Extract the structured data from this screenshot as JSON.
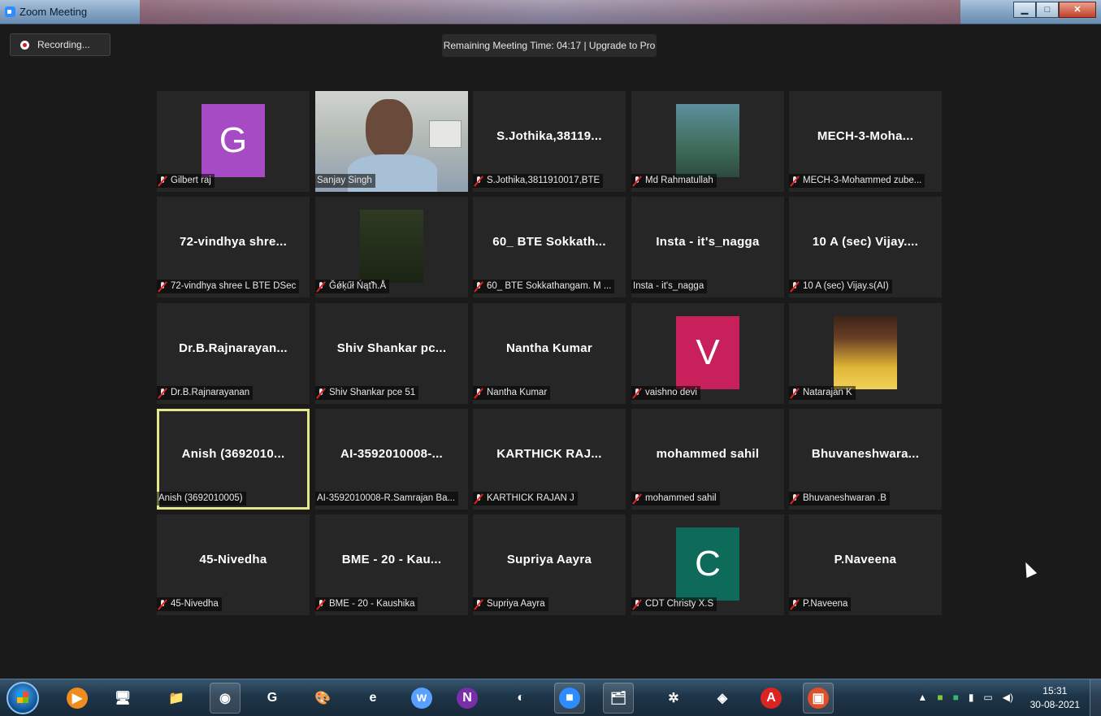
{
  "window": {
    "title": "Zoom Meeting"
  },
  "toolbar": {
    "recording_label": "Recording..."
  },
  "banner": {
    "remaining_text": "Remaining Meeting Time: 04:17 | Upgrade to Pro"
  },
  "tiles": [
    {
      "display": "",
      "name": "Gilbert raj",
      "avatar_letter": "G",
      "avatar_color": "#a64bc4",
      "muted": true
    },
    {
      "display": "",
      "name": "Sanjay Singh",
      "muted": false,
      "video": true
    },
    {
      "display": "S.Jothika,38119...",
      "name": "S.Jothika,3811910017,BTE",
      "muted": true
    },
    {
      "display": "",
      "name": "Md Rahmatullah",
      "muted": true,
      "photo": true
    },
    {
      "display": "MECH-3-Moha...",
      "name": "MECH-3-Mohammed zube...",
      "muted": true
    },
    {
      "display": "72-vindhya shre...",
      "name": "72-vindhya shree L BTE DSec",
      "muted": true
    },
    {
      "display": "",
      "name": "Ğǿķűł Ńąťħ.Å",
      "muted": true,
      "photo": true
    },
    {
      "display": "60_ BTE Sokkath...",
      "name": "60_ BTE Sokkathangam. M ...",
      "muted": true
    },
    {
      "display": "Insta - it's_nagga",
      "name": "Insta - it's_nagga",
      "muted": false
    },
    {
      "display": "10 A (sec) Vijay....",
      "name": "10 A (sec) Vijay.s(AI)",
      "muted": true
    },
    {
      "display": "Dr.B.Rajnarayan...",
      "name": "Dr.B.Rajnarayanan",
      "muted": true
    },
    {
      "display": "Shiv Shankar pc...",
      "name": "Shiv Shankar pce 51",
      "muted": true
    },
    {
      "display": "Nantha Kumar",
      "name": "Nantha Kumar",
      "muted": true
    },
    {
      "display": "",
      "name": "vaishno devi",
      "avatar_letter": "V",
      "avatar_color": "#c7205a",
      "muted": true
    },
    {
      "display": "",
      "name": "Natarajan K",
      "muted": true,
      "photo": true
    },
    {
      "display": "Anish (3692010...",
      "name": "Anish (3692010005)",
      "muted": false,
      "active": true
    },
    {
      "display": "AI-3592010008-...",
      "name": "AI-3592010008-R.Samrajan Ba...",
      "muted": false
    },
    {
      "display": "KARTHICK RAJ...",
      "name": "KARTHICK RAJAN J",
      "muted": true
    },
    {
      "display": "mohammed sahil",
      "name": "mohammed sahil",
      "muted": true
    },
    {
      "display": "Bhuvaneshwara...",
      "name": "Bhuvaneshwaran .B",
      "muted": true
    },
    {
      "display": "45-Nivedha",
      "name": "45-Nivedha",
      "muted": true
    },
    {
      "display": "BME  -  20 - Kau...",
      "name": "BME  -  20 - Kaushika",
      "muted": true
    },
    {
      "display": "Supriya Aayra",
      "name": "Supriya Aayra",
      "muted": true
    },
    {
      "display": "",
      "name": "CDT Christy X.S",
      "avatar_letter": "C",
      "avatar_color": "#0e6b5a",
      "muted": true
    },
    {
      "display": "P.Naveena",
      "name": "P.Naveena",
      "muted": true
    }
  ],
  "taskbar": {
    "icons": [
      "start-icon",
      "media-player-icon",
      "remote-icon",
      "explorer-icon",
      "chrome-icon",
      "greenshot-icon",
      "paint-icon",
      "ie-icon",
      "browser-u-icon",
      "onenote-icon",
      "obs-icon",
      "zoom-icon",
      "file-manager-icon",
      "network-app-icon",
      "git-icon",
      "pdf-icon",
      "presenter-icon"
    ],
    "time": "15:31",
    "date": "30-08-2021"
  }
}
